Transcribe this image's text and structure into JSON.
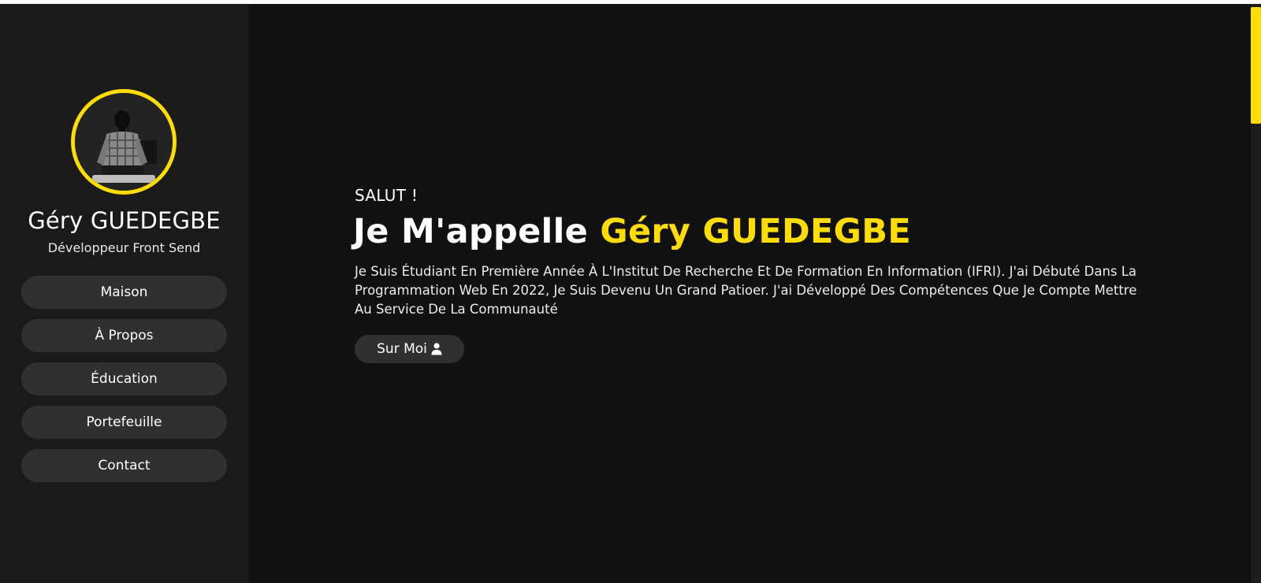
{
  "sidebar": {
    "profile_name": "Géry GUEDEGBE",
    "profile_role": "Développeur Front Send",
    "avatar_icon": "person-photo",
    "nav_items": [
      {
        "label": "Maison"
      },
      {
        "label": "À Propos"
      },
      {
        "label": "Éducation"
      },
      {
        "label": "Portefeuille"
      },
      {
        "label": "Contact"
      }
    ]
  },
  "hero": {
    "greeting": "SALUT !",
    "headline_prefix": "Je M'appelle",
    "headline_name": "Géry GUEDEGBE",
    "intro": "Je Suis Étudiant En Première Année À L'Institut De Recherche Et De Formation En Information (IFRI). J'ai Débuté Dans La Programmation Web En 2022, Je Suis Devenu Un Grand Patioer. J'ai Développé Des Compétences Que Je Compte Mettre Au Service De La Communauté",
    "about_button_label": "Sur Moi",
    "about_button_icon": "user-icon"
  },
  "colors": {
    "accent": "#ffdd00",
    "sidebar_bg": "#1a1a1a",
    "main_bg": "#111111",
    "button_bg": "#303030"
  }
}
